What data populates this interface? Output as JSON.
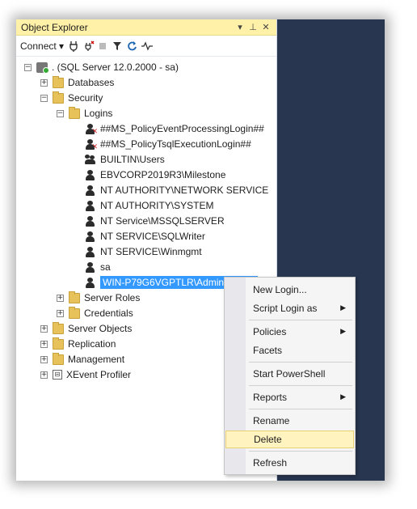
{
  "panel": {
    "title": "Object Explorer",
    "controls": [
      "▾",
      "⊥",
      "✕"
    ]
  },
  "toolbar": {
    "connect_label": "Connect ▾",
    "icons": [
      "connect-icon",
      "disconnect-icon",
      "stop-icon",
      "filter-icon",
      "refresh-icon",
      "activity-icon"
    ]
  },
  "tree": {
    "server": ". (SQL Server 12.0.2000 - sa)",
    "databases": "Databases",
    "security": "Security",
    "logins": "Logins",
    "login_items": [
      {
        "label": "##MS_PolicyEventProcessingLogin##",
        "type": "disabled-user"
      },
      {
        "label": "##MS_PolicyTsqlExecutionLogin##",
        "type": "disabled-user"
      },
      {
        "label": "BUILTIN\\Users",
        "type": "group"
      },
      {
        "label": "EBVCORP2019R3\\Milestone",
        "type": "user"
      },
      {
        "label": "NT AUTHORITY\\NETWORK SERVICE",
        "type": "user"
      },
      {
        "label": "NT AUTHORITY\\SYSTEM",
        "type": "user"
      },
      {
        "label": "NT Service\\MSSQLSERVER",
        "type": "user"
      },
      {
        "label": "NT SERVICE\\SQLWriter",
        "type": "user"
      },
      {
        "label": "NT SERVICE\\Winmgmt",
        "type": "user"
      },
      {
        "label": "sa",
        "type": "user"
      },
      {
        "label": "WIN-P79G6VGPTLR\\Administrator",
        "type": "user",
        "selected": true
      }
    ],
    "server_roles": "Server Roles",
    "credentials": "Credentials",
    "server_objects": "Server Objects",
    "replication": "Replication",
    "management": "Management",
    "xevent_profiler": "XEvent Profiler"
  },
  "context_menu": {
    "items": [
      {
        "label": "New Login..."
      },
      {
        "label": "Script Login as",
        "submenu": true
      },
      {
        "label": "Policies",
        "submenu": true
      },
      {
        "label": "Facets"
      },
      {
        "label": "Start PowerShell"
      },
      {
        "label": "Reports",
        "submenu": true
      },
      {
        "label": "Rename"
      },
      {
        "label": "Delete",
        "highlighted": true
      },
      {
        "label": "Refresh"
      }
    ],
    "highlight_color": "#fff3c0"
  },
  "colors": {
    "title_bar": "#fff1a8",
    "selection": "#3399ff",
    "dark_background": "#283650"
  }
}
